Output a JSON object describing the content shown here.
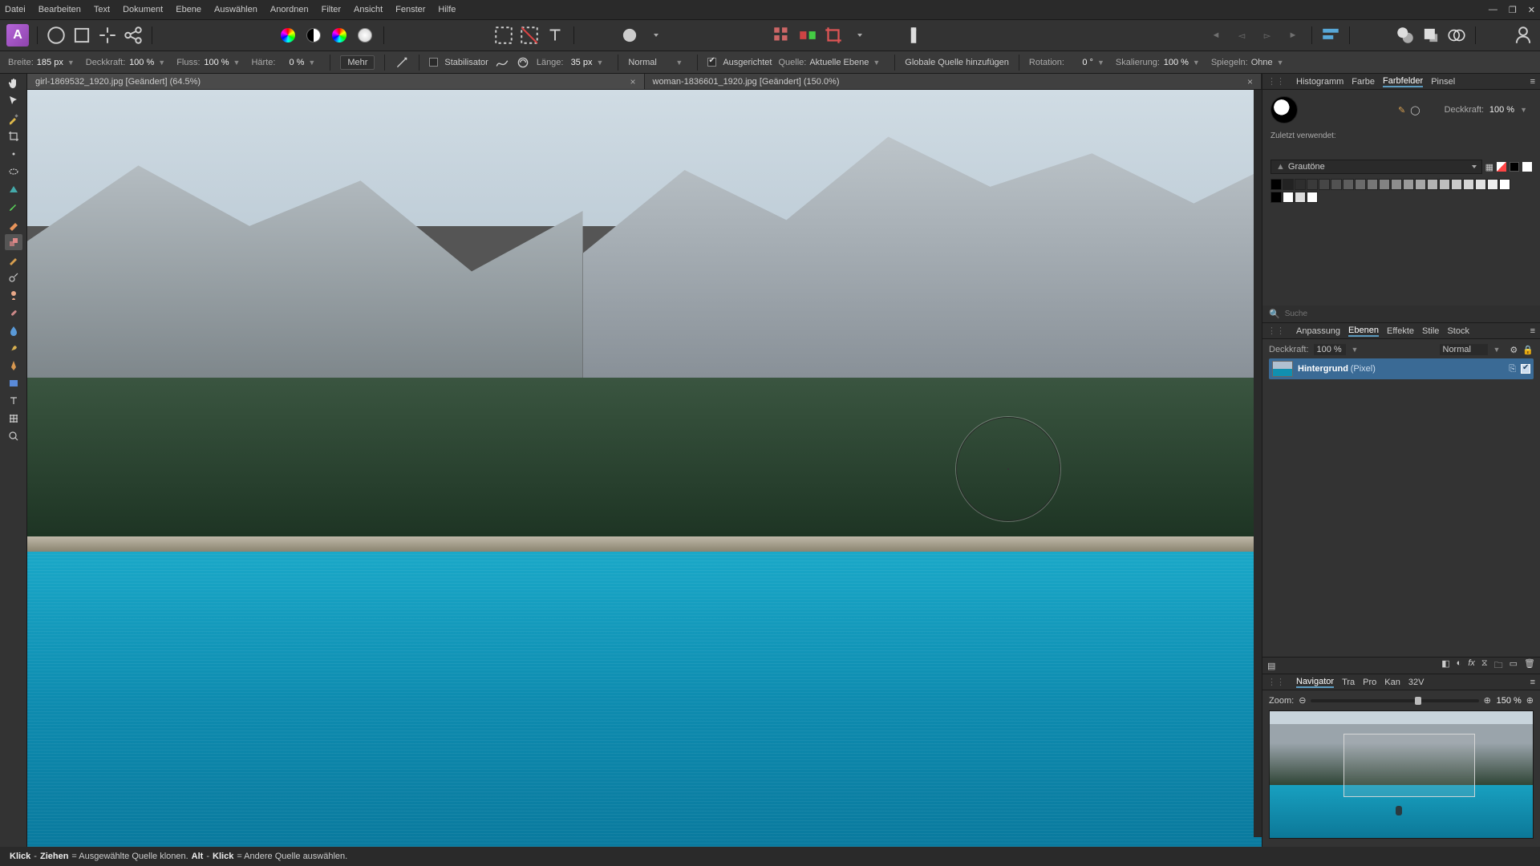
{
  "menu": [
    "Datei",
    "Bearbeiten",
    "Text",
    "Dokument",
    "Ebene",
    "Auswählen",
    "Anordnen",
    "Filter",
    "Ansicht",
    "Fenster",
    "Hilfe"
  ],
  "context": {
    "width_label": "Breite:",
    "width_val": "185 px",
    "opacity_label": "Deckkraft:",
    "opacity_val": "100 %",
    "flow_label": "Fluss:",
    "flow_val": "100 %",
    "hardness_label": "Härte:",
    "hardness_val": "0 %",
    "more": "Mehr",
    "stabiliser": "Stabilisator",
    "length_label": "Länge:",
    "length_val": "35 px",
    "blend": "Normal",
    "aligned": "Ausgerichtet",
    "source_label": "Quelle:",
    "source_val": "Aktuelle Ebene",
    "global_source": "Globale Quelle hinzufügen",
    "rotation_label": "Rotation:",
    "rotation_val": "0 °",
    "scale_label": "Skalierung:",
    "scale_val": "100 %",
    "mirror_label": "Spiegeln:",
    "mirror_val": "Ohne"
  },
  "tabs": [
    {
      "title": "girl-1869532_1920.jpg [Geändert] (64.5%)",
      "active": true
    },
    {
      "title": "woman-1836601_1920.jpg [Geändert] (150.0%)",
      "active": false
    }
  ],
  "right_tabs1": [
    "Histogramm",
    "Farbe",
    "Farbfelder",
    "Pinsel"
  ],
  "swatch": {
    "opacity_label": "Deckkraft:",
    "opacity_val": "100 %",
    "recent_label": "Zuletzt verwendet:",
    "palette": "Grautöne"
  },
  "search": {
    "placeholder": "Suche"
  },
  "right_tabs2": [
    "Anpassung",
    "Ebenen",
    "Effekte",
    "Stile",
    "Stock"
  ],
  "layers": {
    "opacity_label": "Deckkraft:",
    "opacity_val": "100 %",
    "blend": "Normal",
    "layer_name": "Hintergrund",
    "layer_type": "(Pixel)"
  },
  "right_tabs3": [
    "Navigator",
    "Tra",
    "Pro",
    "Kan",
    "32V"
  ],
  "nav": {
    "zoom_label": "Zoom:",
    "zoom_val": "150 %"
  },
  "status": {
    "s1": "Klick",
    "s2": "-",
    "s3": "Ziehen",
    "s4": " = Ausgewählte Quelle klonen. ",
    "s5": "Alt",
    "s6": "-",
    "s7": "Klick",
    "s8": " = Andere Quelle auswählen."
  },
  "grayscale": [
    "#000",
    "#222",
    "#2e2e2e",
    "#3a3a3a",
    "#464646",
    "#525252",
    "#5e5e5e",
    "#6a6a6a",
    "#767676",
    "#828282",
    "#8e8e8e",
    "#9a9a9a",
    "#a6a6a6",
    "#b2b2b2",
    "#bebebe",
    "#cacaca",
    "#d6d6d6",
    "#e2e2e2",
    "#eee",
    "#fff"
  ]
}
